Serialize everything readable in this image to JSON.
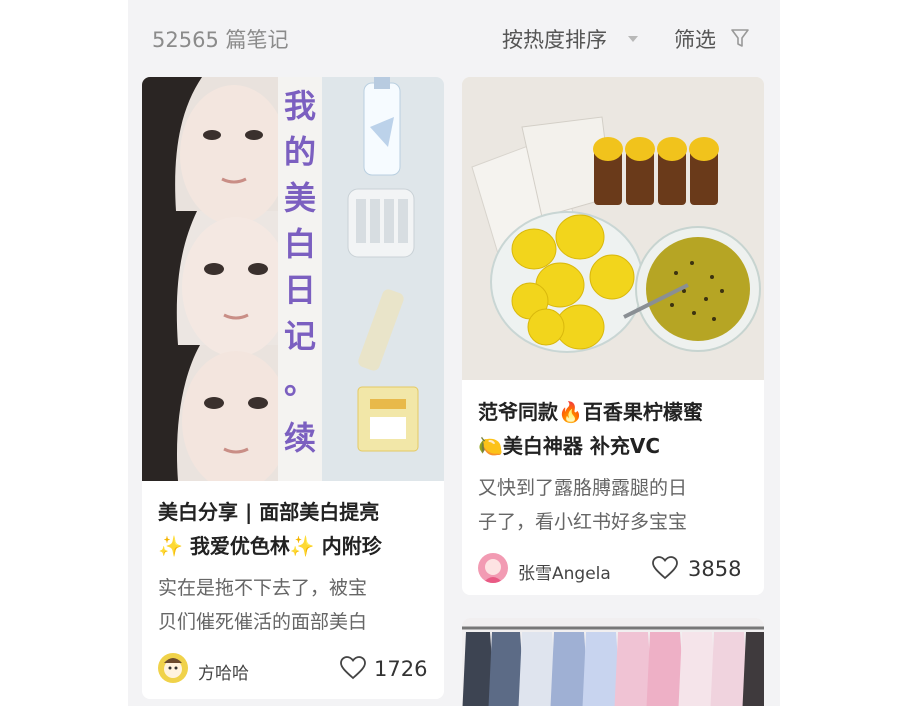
{
  "header": {
    "note_count": "52565 篇笔记",
    "sort_label": "按热度排序",
    "filter_label": "筛选"
  },
  "cards": [
    {
      "cover_text": "我的美白日记 。续",
      "title_line1": "美白分享 | 面部美白提亮",
      "title_line2": "✨ 我爱优色林✨ 内附珍",
      "desc_line1": "实在是拖不下去了，被宝",
      "desc_line2": "贝们催死催活的面部美白",
      "author": "方哈哈",
      "likes": "1726"
    },
    {
      "title_line1": "范爷同款🔥百香果柠檬蜜",
      "title_line2": "🍋美白神器 补充VC",
      "desc_line1": "又快到了露胳膊露腿的日",
      "desc_line2": "子了，看小红书好多宝宝",
      "author": "张雪Angela",
      "likes": "3858"
    }
  ],
  "icons": {
    "filter": "funnel-icon",
    "sort": "caret-down-icon",
    "likes": "heart-outline-icon"
  },
  "colors": {
    "cover_text": "#7b5fc0",
    "lemon": "#f2d51c",
    "background": "#f3f3f5"
  }
}
